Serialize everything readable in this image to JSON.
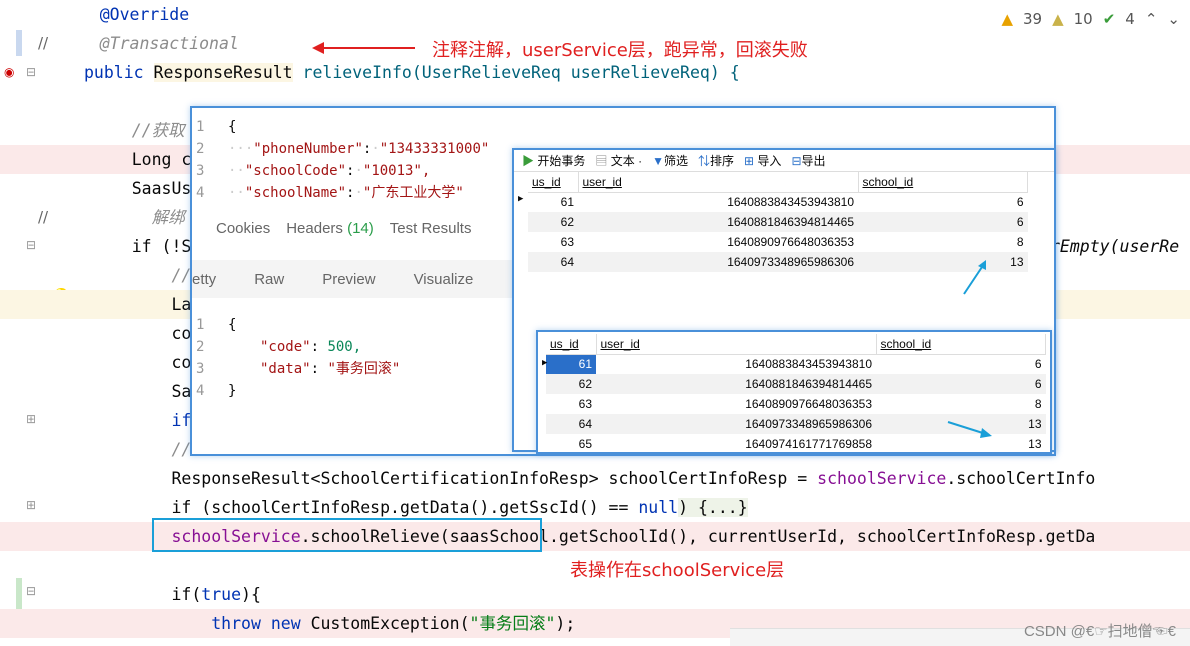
{
  "gutter": {
    "line_comment_marks": [
      "//",
      "//"
    ]
  },
  "code_lines": [
    {
      "id": "l1",
      "text": "    @Override"
    },
    {
      "id": "l2",
      "text": "    @Transactional"
    },
    {
      "id": "l3a",
      "text": "public "
    },
    {
      "id": "l3b",
      "text": "ResponseResult"
    },
    {
      "id": "l3c",
      "text": " relieveInfo(UserRelieveReq userRelieveReq) {"
    },
    {
      "id": "l5",
      "text": "    //获取"
    },
    {
      "id": "l6",
      "text": "    Long c"
    },
    {
      "id": "l7",
      "text": "    SaasUs"
    },
    {
      "id": "l8",
      "text": "      解绑"
    },
    {
      "id": "l9a",
      "text": "    if (!S"
    },
    {
      "id": "l9b",
      "text": "rEmpty(userRe"
    },
    {
      "id": "l10",
      "text": "        //"
    },
    {
      "id": "l11",
      "text": "        La"
    },
    {
      "id": "l12",
      "text": "        co"
    },
    {
      "id": "l13",
      "text": "        co"
    },
    {
      "id": "l14",
      "text": "        Sa"
    },
    {
      "id": "l15",
      "text": "        if"
    },
    {
      "id": "l16",
      "text": "        //"
    },
    {
      "id": "l17a",
      "text": "        ResponseResult<SchoolCertificationInfoResp> schoolCertInfoResp = "
    },
    {
      "id": "l17b",
      "text": "schoolService"
    },
    {
      "id": "l17c",
      "text": ".schoolCertInfo"
    },
    {
      "id": "l18a",
      "text": "        if (schoolCertInfoResp.getData().getSscId() == "
    },
    {
      "id": "l18b",
      "text": "null"
    },
    {
      "id": "l18c",
      "text": ") {...}"
    },
    {
      "id": "l19a",
      "text": "        "
    },
    {
      "id": "l19b",
      "text": "schoolService"
    },
    {
      "id": "l19c",
      "text": ".schoolRelieve(saasSchool.getSchoolId(), currentUserId, schoolCertInfoResp.getDa"
    },
    {
      "id": "l21a",
      "text": "        if("
    },
    {
      "id": "l21b",
      "text": "true"
    },
    {
      "id": "l21c",
      "text": "){"
    },
    {
      "id": "l22a",
      "text": "            "
    },
    {
      "id": "l22b",
      "text": "throw new "
    },
    {
      "id": "l22c",
      "text": "CustomException("
    },
    {
      "id": "l22d",
      "text": "\"事务回滚\""
    },
    {
      "id": "l22e",
      "text": ");"
    }
  ],
  "inspection": {
    "errors": "39",
    "warnings": "10",
    "ok": "4"
  },
  "annotations": {
    "top_note": "注释注解，userService层，跑异常，回滚失败",
    "bottom_note": "表操作在schoolService层"
  },
  "request_popup": {
    "lines": [
      {
        "n": "1",
        "text": "{"
      },
      {
        "n": "2",
        "key": "\"phoneNumber\"",
        "val": "\"13433331000\""
      },
      {
        "n": "3",
        "key": "\"schoolCode\"",
        "val": "\"10013\","
      },
      {
        "n": "4",
        "key": "\"schoolName\"",
        "val": "\"广东工业大学\""
      }
    ],
    "tabs": [
      "Cookies",
      "Headers",
      "(14)",
      "Test Results"
    ],
    "view_tabs": [
      "etty",
      "Raw",
      "Preview",
      "Visualize"
    ],
    "response_lines": [
      {
        "n": "1",
        "text": "{"
      },
      {
        "n": "2",
        "key": "\"code\"",
        "val": "500,"
      },
      {
        "n": "3",
        "key": "\"data\"",
        "val": "\"事务回滚\""
      },
      {
        "n": "4",
        "text": "}"
      }
    ]
  },
  "db_top": {
    "toolbar": [
      "开始事务",
      "文本 ·",
      "筛选",
      "排序",
      "导入",
      "导出"
    ],
    "columns": [
      "us_id",
      "user_id",
      "school_id"
    ],
    "rows": [
      [
        "61",
        "1640883843453943810",
        "6"
      ],
      [
        "62",
        "1640881846394814465",
        "6"
      ],
      [
        "63",
        "1640890976648036353",
        "8"
      ],
      [
        "64",
        "1640973348965986306",
        "13"
      ]
    ]
  },
  "db_bottom": {
    "columns": [
      "us_id",
      "user_id",
      "school_id"
    ],
    "rows": [
      [
        "61",
        "1640883843453943810",
        "6"
      ],
      [
        "62",
        "1640881846394814465",
        "6"
      ],
      [
        "63",
        "1640890976648036353",
        "8"
      ],
      [
        "64",
        "1640973348965986306",
        "13"
      ],
      [
        "65",
        "1640974161771769858",
        "13"
      ]
    ]
  },
  "watermark": "CSDN @€☞扫地僧☜€"
}
